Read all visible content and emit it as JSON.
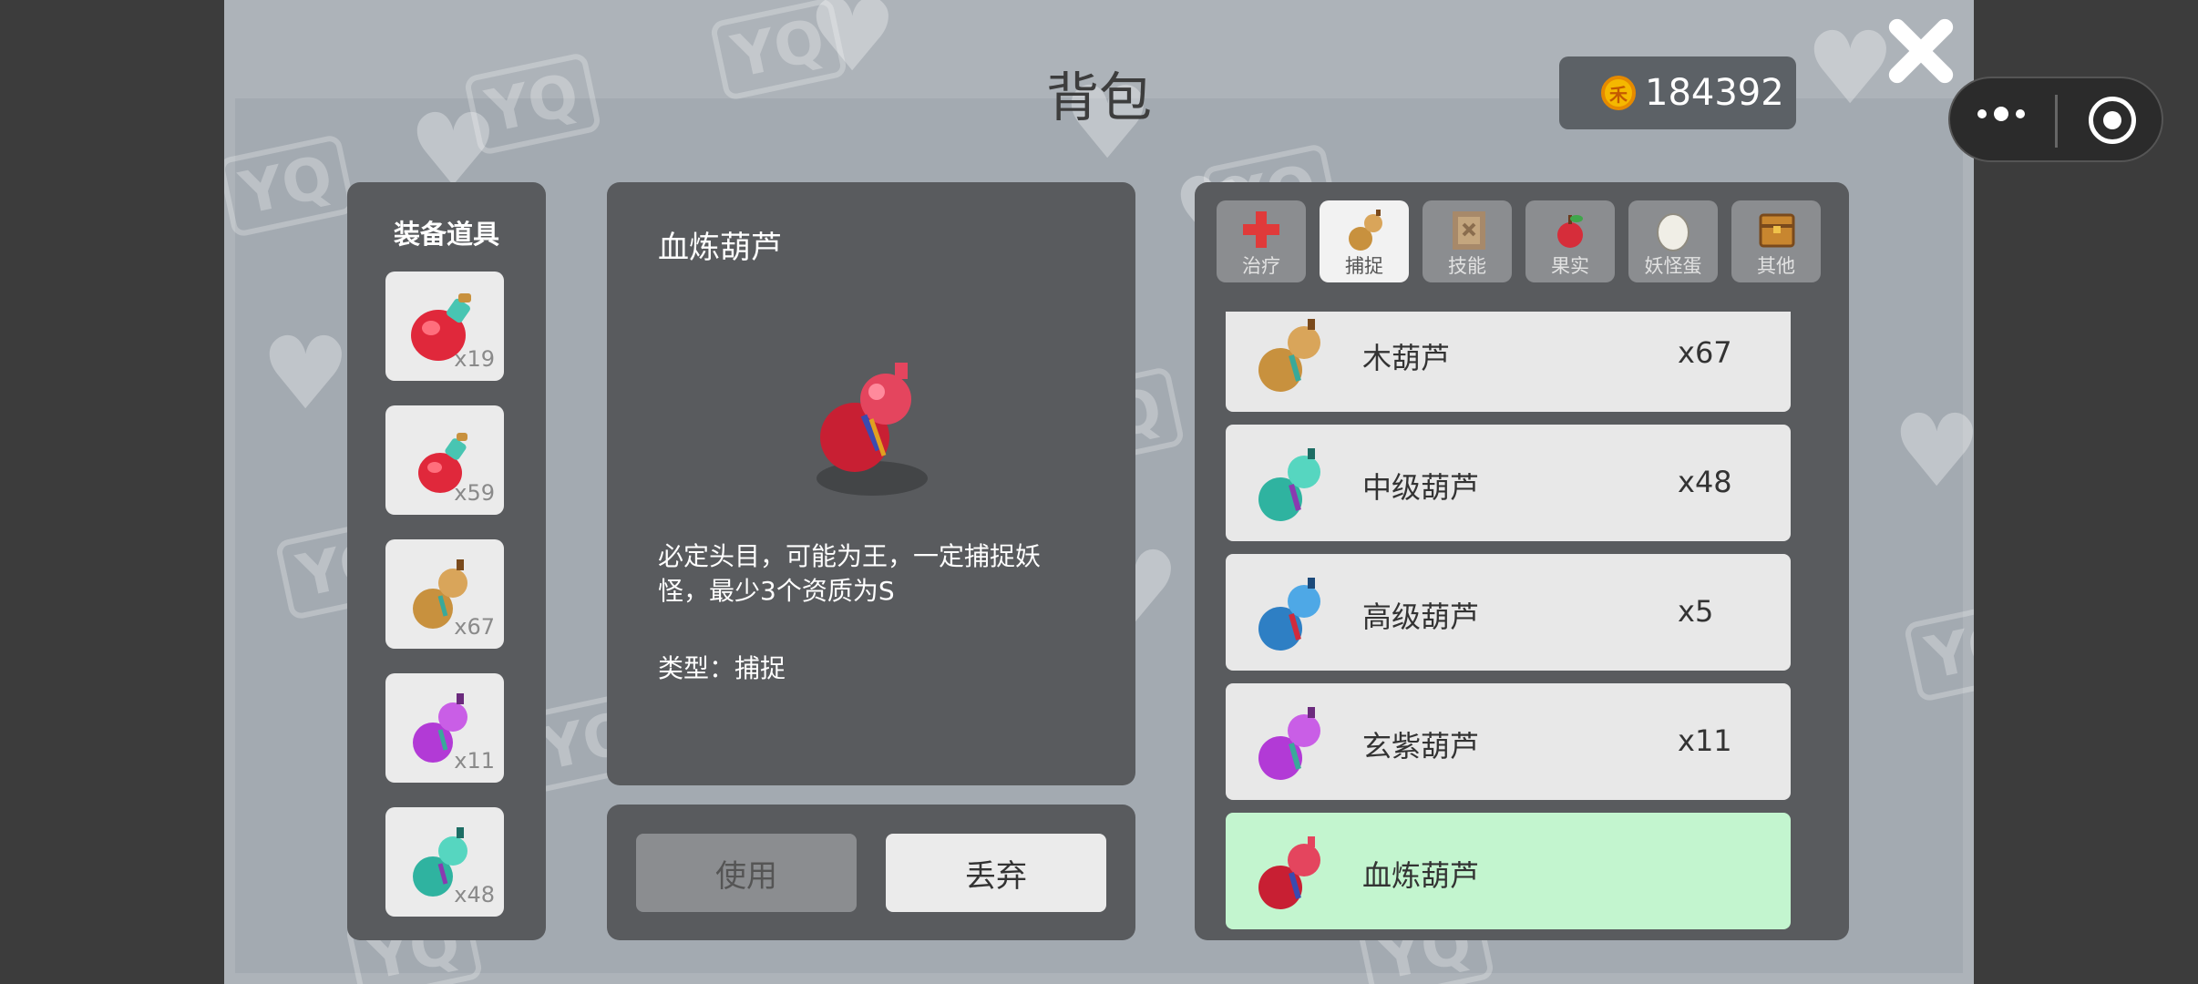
{
  "title": "背包",
  "currency": {
    "amount": "184392",
    "icon": "gold-coin-icon",
    "coin_glyph": "禾"
  },
  "equip_panel": {
    "title": "装备道具",
    "items": [
      {
        "count": "x19",
        "icon": "red-potion-icon"
      },
      {
        "count": "x59",
        "icon": "red-potion-small-icon"
      },
      {
        "count": "x67",
        "icon": "wood-gourd-icon"
      },
      {
        "count": "x11",
        "icon": "purple-gourd-icon"
      },
      {
        "count": "x48",
        "icon": "teal-gourd-icon"
      }
    ]
  },
  "detail": {
    "name": "血炼葫芦",
    "description": "必定头目，可能为王，一定捕捉妖怪，最少3个资质为S",
    "type_label": "类型：捕捉"
  },
  "actions": {
    "use_label": "使用",
    "discard_label": "丢弃"
  },
  "tabs": [
    {
      "label": "治疗",
      "icon": "heal-cross-icon",
      "active": false
    },
    {
      "label": "捕捉",
      "icon": "gourd-icon",
      "active": true
    },
    {
      "label": "技能",
      "icon": "skill-scroll-icon",
      "active": false
    },
    {
      "label": "果实",
      "icon": "fruit-icon",
      "active": false
    },
    {
      "label": "妖怪蛋",
      "icon": "egg-icon",
      "active": false
    },
    {
      "label": "其他",
      "icon": "chest-icon",
      "active": false
    }
  ],
  "list": [
    {
      "name": "木葫芦",
      "count": "x67",
      "icon": "wood-gourd-icon",
      "selected": false
    },
    {
      "name": "中级葫芦",
      "count": "x48",
      "icon": "teal-gourd-icon",
      "selected": false
    },
    {
      "name": "高级葫芦",
      "count": "x5",
      "icon": "blue-gourd-icon",
      "selected": false
    },
    {
      "name": "玄紫葫芦",
      "count": "x11",
      "icon": "purple-gourd-icon",
      "selected": false
    },
    {
      "name": "血炼葫芦",
      "count": "",
      "icon": "blood-gourd-icon",
      "selected": true
    }
  ],
  "colors": {
    "wood": "#c8913e",
    "teal": "#3cc4a8",
    "blue": "#3a8fd0",
    "purple": "#b23ad6",
    "blood": "#d02b3c",
    "selected_row": "#c3f5cf"
  },
  "watermark": "YQ"
}
